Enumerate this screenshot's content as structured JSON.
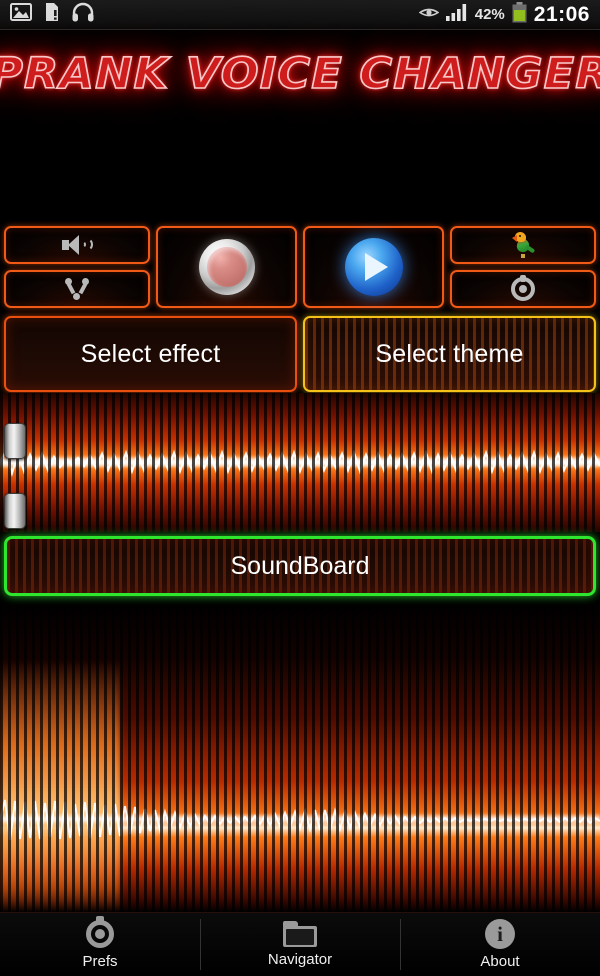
{
  "statusbar": {
    "icons": [
      "image-icon",
      "sim-card-alert-icon",
      "headphones-icon",
      "eye-icon",
      "signal-bars-icon"
    ],
    "battery_percent": "42%",
    "clock": "21:06"
  },
  "header": {
    "title": "PRANK VOICE CHANGER",
    "title_color": "#cf1d1d",
    "glow_color": "#ff3b3b"
  },
  "controls": {
    "speaker_button": {
      "icon": "speaker-icon",
      "label": ""
    },
    "share_button": {
      "icon": "share-nodes-icon",
      "label": ""
    },
    "record_button": {
      "icon": "record-icon",
      "label": ""
    },
    "play_button": {
      "icon": "play-icon",
      "label": ""
    },
    "parrot_button": {
      "icon": "parrot-icon",
      "label": ""
    },
    "settings_button": {
      "icon": "gear-icon",
      "label": ""
    },
    "border_color": "#ef5a16"
  },
  "selectors": {
    "effect_label": "Select effect",
    "effect_border": "#e9500f",
    "theme_label": "Select theme",
    "theme_border": "#f5c21a"
  },
  "soundboard": {
    "label": "SoundBoard",
    "border_color": "#2ee62e"
  },
  "sliders": {
    "top_thumb": "slider-thumb-pitch",
    "bottom_thumb": "slider-thumb-tempo"
  },
  "waveform": {
    "top_panel": "waveform-display-top",
    "bottom_panel": "waveform-display-bottom",
    "accent_color": "#ff7a17"
  },
  "navbar": {
    "items": [
      {
        "icon": "gear-icon",
        "label": "Prefs"
      },
      {
        "icon": "folder-icon",
        "label": "Navigator"
      },
      {
        "icon": "info-icon",
        "label": "About"
      }
    ]
  }
}
